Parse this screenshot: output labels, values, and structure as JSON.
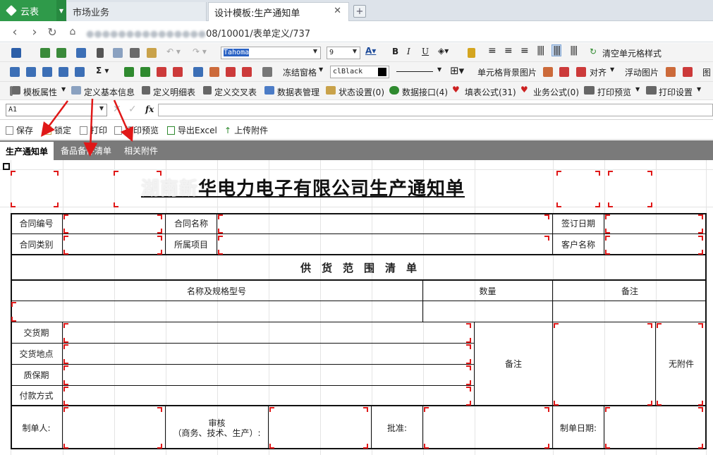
{
  "browser": {
    "app_name": "云表",
    "tabs": [
      {
        "label": "市场业务"
      },
      {
        "label": "设计模板:生产通知单"
      }
    ],
    "url_visible": "08/10001/表单定义/737"
  },
  "toolbar1": {
    "font_name": "Tahoma",
    "font_size": "9",
    "clear_style_label": "清空单元格样式"
  },
  "toolbar2": {
    "freeze_label": "冻结窗格",
    "color_value": "clBlack",
    "cell_bg_label": "单元格背景图片",
    "align_label": "对齐",
    "float_image_label": "浮动图片",
    "trailing_label": "图"
  },
  "toolbar3": {
    "items": [
      "模板属性",
      "定义基本信息",
      "定义明细表",
      "定义交叉表",
      "数据表管理",
      "状态设置(0)",
      "数据接口(4)",
      "填表公式(31)",
      "业务公式(0)",
      "打印预览",
      "打印设置"
    ]
  },
  "formula_bar": {
    "cell_ref": "A1",
    "fx": "fx"
  },
  "actions": [
    "保存",
    "锁定",
    "打印",
    "打印预览",
    "导出Excel",
    "上传附件"
  ],
  "sheet_tabs": [
    "生产通知单",
    "备品备件清单",
    "相关附件"
  ],
  "form": {
    "title_faded": "湖南新",
    "title_main": "华电力电子有限公司生产通知单",
    "labels": {
      "contract_no": "合同编号",
      "contract_name": "合同名称",
      "sign_date": "签订日期",
      "contract_type": "合同类别",
      "project": "所属项目",
      "customer": "客户名称",
      "supply_scope": "供　货　范　围　清　单",
      "name_spec": "名称及规格型号",
      "quantity": "数量",
      "remark_header": "备注",
      "delivery_period": "交货期",
      "delivery_place": "交货地点",
      "warranty": "质保期",
      "payment": "付款方式",
      "remark": "备注",
      "no_attachment": "无附件",
      "maker": "制单人:",
      "review": "审核\n（商务、技术、生产）:",
      "approve": "批准:",
      "make_date": "制单日期:"
    }
  },
  "colors": {
    "brand": "#2f9a4a",
    "annotation_arrow": "#e01818",
    "sheet_tab_bar": "#7a7a7a"
  }
}
